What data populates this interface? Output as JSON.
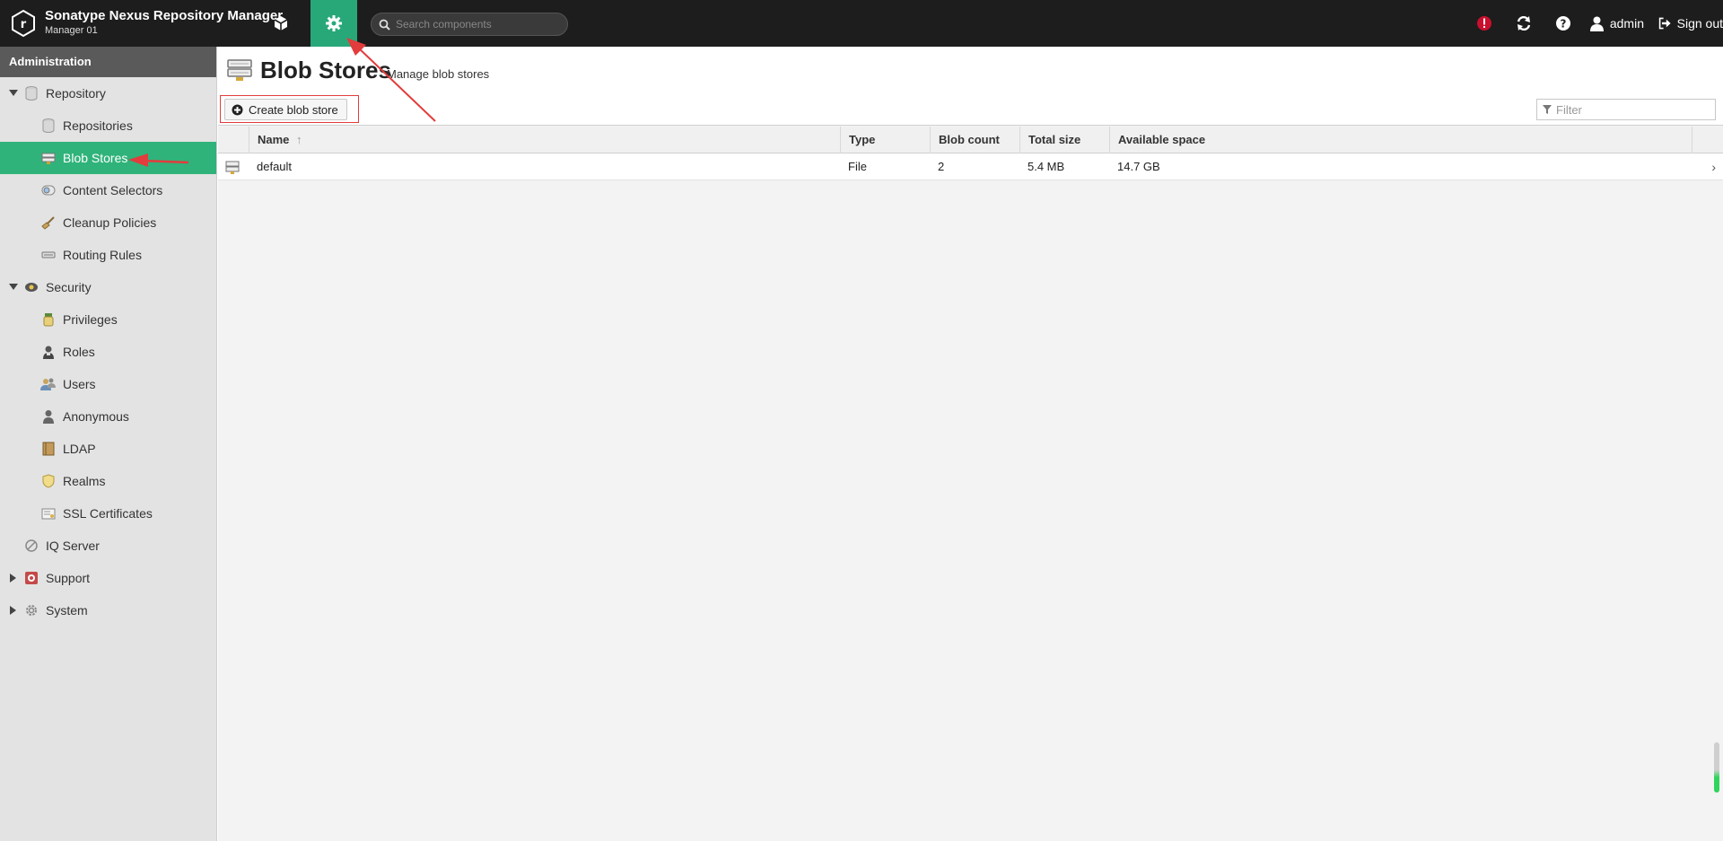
{
  "app": {
    "title": "Sonatype Nexus Repository Manager",
    "subtitle": "Manager 01"
  },
  "header": {
    "browse_icon": "cube-icon",
    "admin_icon": "gear-icon",
    "search": {
      "placeholder": "Search components"
    },
    "right": {
      "alert_icon": "error-alert-icon",
      "refresh_icon": "refresh-icon",
      "help_icon": "help-icon",
      "user_label": "admin",
      "signout_label": "Sign out"
    }
  },
  "sidebar": {
    "header": "Administration",
    "groups": [
      {
        "label": "Repository",
        "icon": "database-icon",
        "expanded": true,
        "items": [
          {
            "label": "Repositories",
            "icon": "database-icon"
          },
          {
            "label": "Blob Stores",
            "icon": "blob-store-icon",
            "active": true
          },
          {
            "label": "Content Selectors",
            "icon": "content-selector-icon"
          },
          {
            "label": "Cleanup Policies",
            "icon": "broom-icon"
          },
          {
            "label": "Routing Rules",
            "icon": "routing-icon"
          }
        ]
      },
      {
        "label": "Security",
        "icon": "eye-badge-icon",
        "expanded": true,
        "items": [
          {
            "label": "Privileges",
            "icon": "medal-icon"
          },
          {
            "label": "Roles",
            "icon": "role-icon"
          },
          {
            "label": "Users",
            "icon": "users-icon"
          },
          {
            "label": "Anonymous",
            "icon": "user-icon"
          },
          {
            "label": "LDAP",
            "icon": "book-icon"
          },
          {
            "label": "Realms",
            "icon": "shield-icon"
          },
          {
            "label": "SSL Certificates",
            "icon": "certificate-icon"
          }
        ]
      },
      {
        "label": "IQ Server",
        "icon": "iq-server-icon"
      },
      {
        "label": "Support",
        "icon": "lifebuoy-icon",
        "expanded": false
      },
      {
        "label": "System",
        "icon": "gear-icon",
        "expanded": false
      }
    ]
  },
  "main": {
    "title": "Blob Stores",
    "subtitle": "Manage blob stores",
    "create_button": "Create blob store",
    "filter_placeholder": "Filter",
    "columns": [
      "Name",
      "Type",
      "Blob count",
      "Total size",
      "Available space"
    ],
    "rows": [
      {
        "name": "default",
        "type": "File",
        "blob_count": "2",
        "total_size": "5.4 MB",
        "available_space": "14.7 GB"
      }
    ]
  },
  "colors": {
    "accent": "#2fb37a",
    "header_bg": "#1d1d1d",
    "annotation_red": "#e23c3c",
    "alert_red": "#c8102e"
  }
}
